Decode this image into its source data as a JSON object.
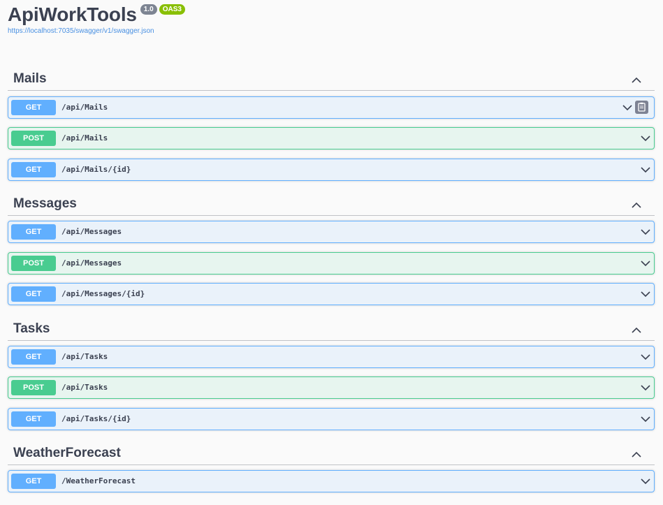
{
  "info": {
    "title": "ApiWorkTools",
    "version": "1.0",
    "oas": "OAS3",
    "spec_url": "https://localhost:7035/swagger/v1/swagger.json"
  },
  "tags": [
    {
      "name": "Mails",
      "operations": [
        {
          "method": "GET",
          "path": "/api/Mails"
        },
        {
          "method": "POST",
          "path": "/api/Mails"
        },
        {
          "method": "GET",
          "path": "/api/Mails/{id}"
        }
      ]
    },
    {
      "name": "Messages",
      "operations": [
        {
          "method": "GET",
          "path": "/api/Messages"
        },
        {
          "method": "POST",
          "path": "/api/Messages"
        },
        {
          "method": "GET",
          "path": "/api/Messages/{id}"
        }
      ]
    },
    {
      "name": "Tasks",
      "operations": [
        {
          "method": "GET",
          "path": "/api/Tasks"
        },
        {
          "method": "POST",
          "path": "/api/Tasks"
        },
        {
          "method": "GET",
          "path": "/api/Tasks/{id}"
        }
      ]
    },
    {
      "name": "WeatherForecast",
      "operations": [
        {
          "method": "GET",
          "path": "/WeatherForecast"
        }
      ]
    }
  ],
  "colors": {
    "get": "#61affe",
    "post": "#49cc90",
    "version_badge": "#7d8492",
    "oas_badge": "#89bf04",
    "link": "#4990e2"
  },
  "icons": {
    "collapse": "chevron-up-icon",
    "expand": "chevron-down-icon",
    "copy": "copy-to-clipboard-icon"
  }
}
